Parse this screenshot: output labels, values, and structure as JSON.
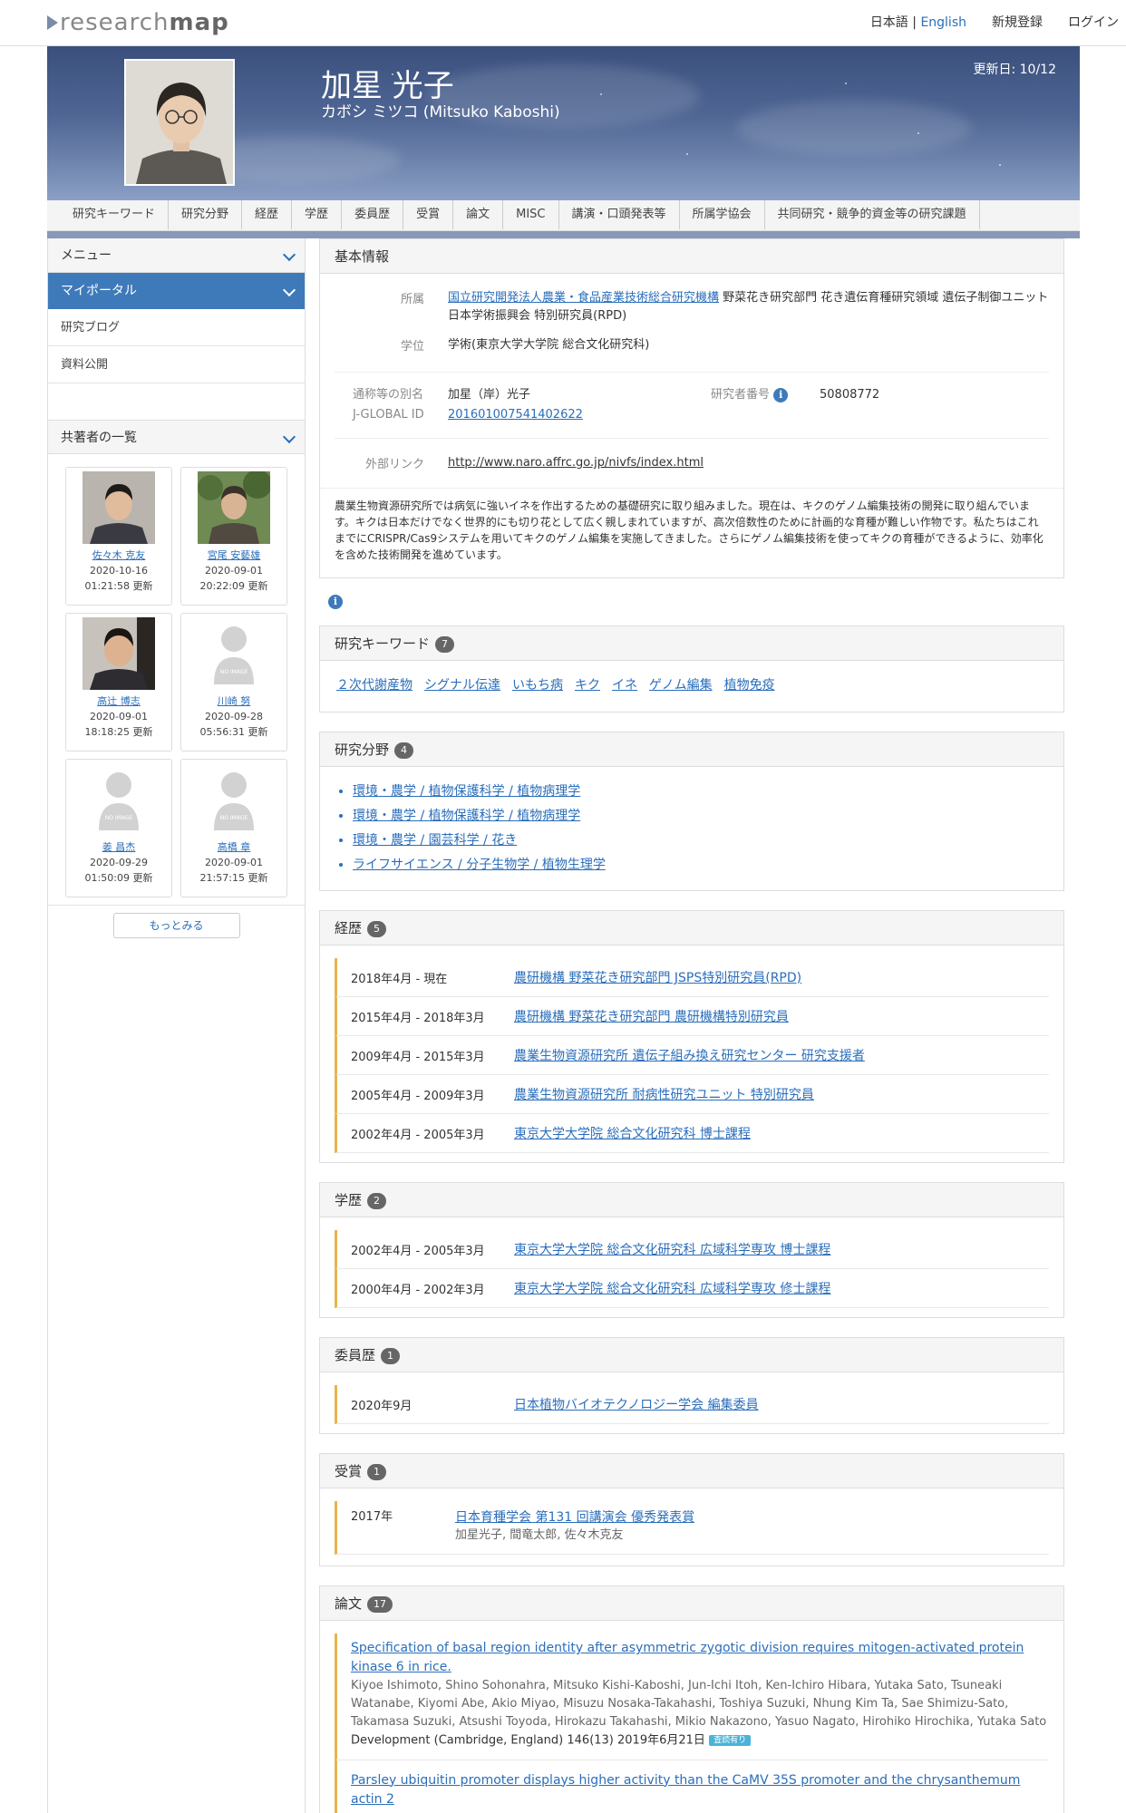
{
  "header": {
    "logo_light": "research",
    "logo_strong": "map",
    "lang_ja": "日本語",
    "lang_sep": " | ",
    "lang_en": "English",
    "register": "新規登録",
    "login": "ログイン"
  },
  "profile": {
    "name": "加星 光子",
    "kana": "カボシ ミツコ  (Mitsuko Kaboshi)",
    "updated": "更新日: 10/12"
  },
  "tabs": [
    "研究キーワード",
    "研究分野",
    "経歴",
    "学歴",
    "委員歴",
    "受賞",
    "論文",
    "MISC",
    "講演・口頭発表等",
    "所属学協会",
    "共同研究・競争的資金等の研究課題"
  ],
  "sidebar": {
    "menu": "メニュー",
    "portal": "マイポータル",
    "blog": "研究ブログ",
    "materials": "資料公開",
    "coauthors_head": "共著者の一覧",
    "more": "もっとみる",
    "coauthors": [
      {
        "name": "佐々木 克友",
        "date": "2020-10-16",
        "time": "01:21:58 更新"
      },
      {
        "name": "宮尾 安藝雄",
        "date": "2020-09-01",
        "time": "20:22:09 更新"
      },
      {
        "name": "高辻 博志",
        "date": "2020-09-01",
        "time": "18:18:25 更新"
      },
      {
        "name": "川崎 努",
        "date": "2020-09-28",
        "time": "05:56:31 更新"
      },
      {
        "name": "姜 昌杰",
        "date": "2020-09-29",
        "time": "01:50:09 更新"
      },
      {
        "name": "高橋 章",
        "date": "2020-09-01",
        "time": "21:57:15 更新"
      }
    ],
    "no_image": "NO IMAGE"
  },
  "basic": {
    "head": "基本情報",
    "aff_label": "所属",
    "aff_link": "国立研究開発法人農業・食品産業技術総合研究機構",
    "aff_rest": " 野菜花き研究部門 花き遺伝育種研究領域 遺伝子制御ユニット 日本学術振興会 特別研究員(RPD)",
    "degree_label": "学位",
    "degree": "学術(東京大学大学院 総合文化研究科)",
    "alias_label": "通称等の別名",
    "alias": "加星（岸）光子",
    "rid_label": "研究者番号",
    "rid": "50808772",
    "jg_label": "J-GLOBAL ID",
    "jg": "201601007541402622",
    "ext_label": "外部リンク",
    "ext": "http://www.naro.affrc.go.jp/nivfs/index.html",
    "abstract": "農業生物資源研究所では病気に強いイネを作出するための基礎研究に取り組みました。現在は、キクのゲノム編集技術の開発に取り組んでいます。キクは日本だけでなく世界的にも切り花として広く親しまれていますが、高次倍数性のために計画的な育種が難しい作物です。私たちはこれまでにCRISPR/Cas9システムを用いてキクのゲノム編集を実施してきました。さらにゲノム編集技術を使ってキクの育種ができるように、効率化を含めた技術開発を進めています。"
  },
  "keywords": {
    "head": "研究キーワード",
    "count": "7",
    "items": [
      "２次代謝産物",
      "シグナル伝達",
      "いもち病",
      "キク",
      "イネ",
      "ゲノム編集",
      "植物免疫"
    ]
  },
  "fields": {
    "head": "研究分野",
    "count": "4",
    "items": [
      "環境・農学 / 植物保護科学 / 植物病理学",
      "環境・農学 / 植物保護科学 / 植物病理学",
      "環境・農学 / 園芸科学 / 花き",
      "ライフサイエンス / 分子生物学 / 植物生理学"
    ]
  },
  "career": {
    "head": "経歴",
    "count": "5",
    "items": [
      {
        "date": "2018年4月 - 現在",
        "title": "農研機構 野菜花き研究部門 JSPS特別研究員(RPD)"
      },
      {
        "date": "2015年4月 - 2018年3月",
        "title": "農研機構 野菜花き研究部門 農研機構特別研究員"
      },
      {
        "date": "2009年4月 - 2015年3月",
        "title": "農業生物資源研究所 遺伝子組み換え研究センター 研究支援者"
      },
      {
        "date": "2005年4月 - 2009年3月",
        "title": "農業生物資源研究所 耐病性研究ユニット 特別研究員"
      },
      {
        "date": "2002年4月 - 2005年3月",
        "title": "東京大学大学院 総合文化研究科 博士課程"
      }
    ]
  },
  "education": {
    "head": "学歴",
    "count": "2",
    "items": [
      {
        "date": "2002年4月 - 2005年3月",
        "title": "東京大学大学院 総合文化研究科 広域科学専攻 博士課程"
      },
      {
        "date": "2000年4月 - 2002年3月",
        "title": "東京大学大学院 総合文化研究科 広域科学専攻 修士課程"
      }
    ]
  },
  "committee": {
    "head": "委員歴",
    "count": "1",
    "items": [
      {
        "date": "2020年9月",
        "title": "日本植物バイオテクノロジー学会 編集委員"
      }
    ]
  },
  "awards": {
    "head": "受賞",
    "count": "1",
    "date": "2017年",
    "title": "日本育種学会 第131 回講演会 優秀発表賞",
    "people": "加星光子, 間竜太郎, 佐々木克友"
  },
  "papers": {
    "head": "論文",
    "count": "17",
    "p1_title": "Specification of basal region identity after asymmetric zygotic division requires mitogen-activated protein kinase 6 in rice.",
    "p1_authors": "Kiyoe Ishimoto, Shino Sohonahra, Mitsuko Kishi-Kaboshi, Jun-Ichi Itoh, Ken-Ichiro Hibara, Yutaka Sato, Tsuneaki Watanabe, Kiyomi Abe, Akio Miyao, Misuzu Nosaka-Takahashi, Toshiya Suzuki, Nhung Kim Ta, Sae Shimizu-Sato, Takamasa Suzuki, Atsushi Toyoda, Hirokazu Takahashi, Mikio Nakazono, Yasuo Nagato, Hirohiko Hirochika, Yutaka Sato",
    "p1_journal": "Development (Cambridge, England) 146(13) 2019年6月21日",
    "p1_badge": "査読有り",
    "p2_title": "Parsley ubiquitin promoter displays higher activity than the CaMV 35S promoter and the chrysanthemum actin 2"
  },
  "colors": {
    "accent": "#2a6ebb",
    "sidebar_active": "#3e7ab9",
    "timeline": "#e8b54a"
  }
}
